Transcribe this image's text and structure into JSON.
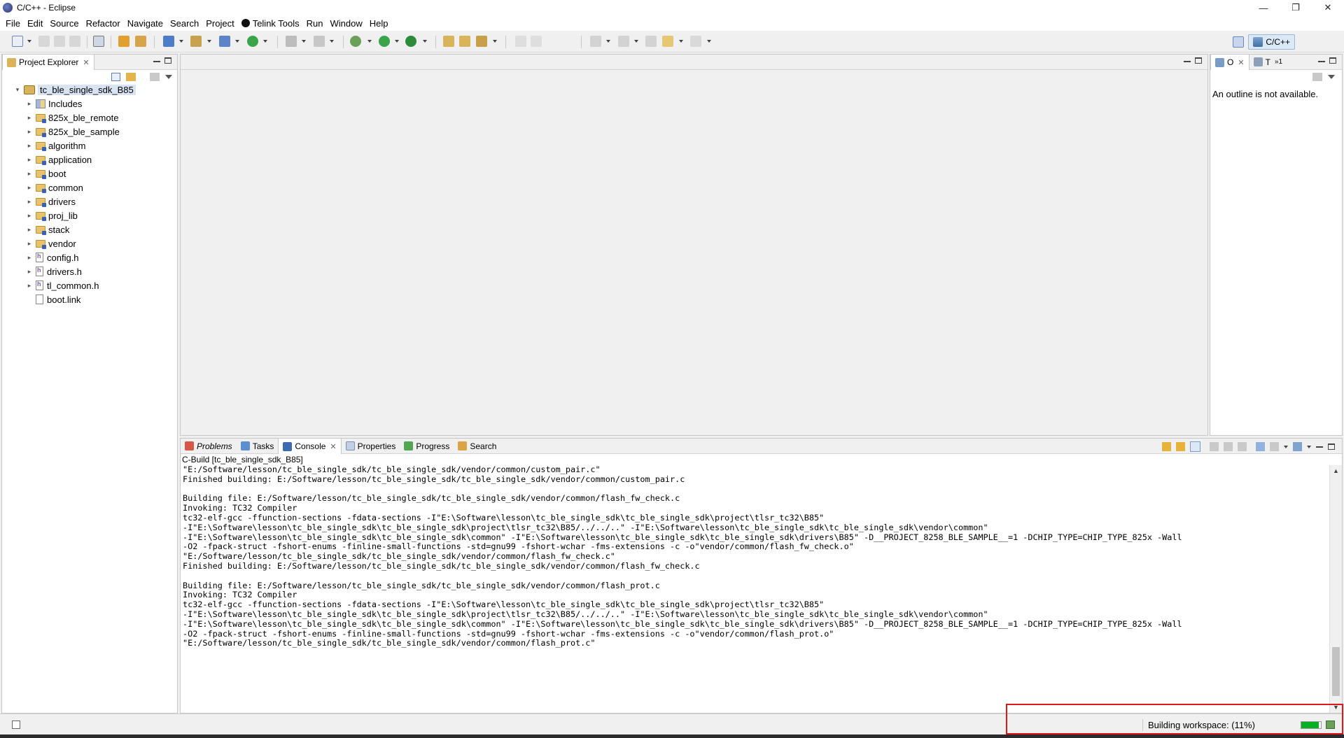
{
  "window": {
    "title": "C/C++ - Eclipse",
    "controls": [
      "—",
      "❐",
      "✕"
    ]
  },
  "menu": [
    "File",
    "Edit",
    "Source",
    "Refactor",
    "Navigate",
    "Search",
    "Project",
    "Telink Tools",
    "Run",
    "Window",
    "Help"
  ],
  "perspective": {
    "label": "C/C++"
  },
  "project_explorer": {
    "tab_label": "Project Explorer",
    "root": "tc_ble_single_sdk_B85",
    "items": [
      {
        "label": "Includes",
        "kind": "includes"
      },
      {
        "label": "825x_ble_remote",
        "kind": "folder"
      },
      {
        "label": "825x_ble_sample",
        "kind": "folder"
      },
      {
        "label": "algorithm",
        "kind": "folder"
      },
      {
        "label": "application",
        "kind": "folder"
      },
      {
        "label": "boot",
        "kind": "folder"
      },
      {
        "label": "common",
        "kind": "folder"
      },
      {
        "label": "drivers",
        "kind": "folder"
      },
      {
        "label": "proj_lib",
        "kind": "folder"
      },
      {
        "label": "stack",
        "kind": "folder"
      },
      {
        "label": "vendor",
        "kind": "folder"
      },
      {
        "label": "config.h",
        "kind": "header"
      },
      {
        "label": "drivers.h",
        "kind": "header"
      },
      {
        "label": "tl_common.h",
        "kind": "header"
      },
      {
        "label": "boot.link",
        "kind": "file"
      }
    ]
  },
  "outline": {
    "tab1": "O",
    "tab2": "T",
    "tab3": "1",
    "message": "An outline is not available."
  },
  "bottom_tabs": [
    {
      "label": "Problems",
      "active": false
    },
    {
      "label": "Tasks",
      "active": false
    },
    {
      "label": "Console",
      "active": true
    },
    {
      "label": "Properties",
      "active": false
    },
    {
      "label": "Progress",
      "active": false
    },
    {
      "label": "Search",
      "active": false
    }
  ],
  "console": {
    "title": "C-Build [tc_ble_single_sdk_B85]",
    "lines": [
      "\"E:/Software/lesson/tc_ble_single_sdk/tc_ble_single_sdk/vendor/common/custom_pair.c\"",
      "Finished building: E:/Software/lesson/tc_ble_single_sdk/tc_ble_single_sdk/vendor/common/custom_pair.c",
      "",
      "Building file: E:/Software/lesson/tc_ble_single_sdk/tc_ble_single_sdk/vendor/common/flash_fw_check.c",
      "Invoking: TC32 Compiler",
      "tc32-elf-gcc -ffunction-sections -fdata-sections -I\"E:\\Software\\lesson\\tc_ble_single_sdk\\tc_ble_single_sdk\\project\\tlsr_tc32\\B85\"",
      "-I\"E:\\Software\\lesson\\tc_ble_single_sdk\\tc_ble_single_sdk\\project\\tlsr_tc32\\B85/../../..\" -I\"E:\\Software\\lesson\\tc_ble_single_sdk\\tc_ble_single_sdk\\vendor\\common\"",
      "-I\"E:\\Software\\lesson\\tc_ble_single_sdk\\tc_ble_single_sdk\\common\" -I\"E:\\Software\\lesson\\tc_ble_single_sdk\\tc_ble_single_sdk\\drivers\\B85\" -D__PROJECT_8258_BLE_SAMPLE__=1 -DCHIP_TYPE=CHIP_TYPE_825x -Wall",
      "-O2 -fpack-struct -fshort-enums -finline-small-functions -std=gnu99 -fshort-wchar -fms-extensions -c -o\"vendor/common/flash_fw_check.o\"",
      "\"E:/Software/lesson/tc_ble_single_sdk/tc_ble_single_sdk/vendor/common/flash_fw_check.c\"",
      "Finished building: E:/Software/lesson/tc_ble_single_sdk/tc_ble_single_sdk/vendor/common/flash_fw_check.c",
      "",
      "Building file: E:/Software/lesson/tc_ble_single_sdk/tc_ble_single_sdk/vendor/common/flash_prot.c",
      "Invoking: TC32 Compiler",
      "tc32-elf-gcc -ffunction-sections -fdata-sections -I\"E:\\Software\\lesson\\tc_ble_single_sdk\\tc_ble_single_sdk\\project\\tlsr_tc32\\B85\"",
      "-I\"E:\\Software\\lesson\\tc_ble_single_sdk\\tc_ble_single_sdk\\project\\tlsr_tc32\\B85/../../..\" -I\"E:\\Software\\lesson\\tc_ble_single_sdk\\tc_ble_single_sdk\\vendor\\common\"",
      "-I\"E:\\Software\\lesson\\tc_ble_single_sdk\\tc_ble_single_sdk\\common\" -I\"E:\\Software\\lesson\\tc_ble_single_sdk\\tc_ble_single_sdk\\drivers\\B85\" -D__PROJECT_8258_BLE_SAMPLE__=1 -DCHIP_TYPE=CHIP_TYPE_825x -Wall",
      "-O2 -fpack-struct -fshort-enums -finline-small-functions -std=gnu99 -fshort-wchar -fms-extensions -c -o\"vendor/common/flash_prot.o\"",
      "\"E:/Software/lesson/tc_ble_single_sdk/tc_ble_single_sdk/vendor/common/flash_prot.c\"",
      ""
    ]
  },
  "status": {
    "text": "Building workspace: (11%)",
    "progress": 0.89
  },
  "colors": {
    "accent": "#06b025",
    "highlight": "#e0161d",
    "selection": "#d9e4f2"
  }
}
